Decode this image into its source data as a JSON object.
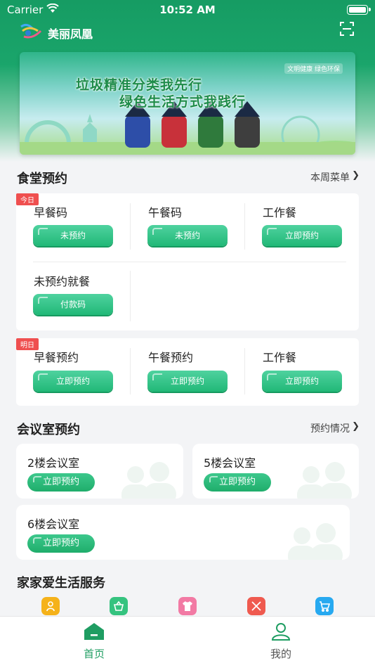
{
  "status_bar": {
    "carrier": "Carrier",
    "time": "10:52 AM"
  },
  "header": {
    "title": "美丽凤凰"
  },
  "banner": {
    "line1": "垃圾精准分类我先行",
    "line2": "绿色生活方式我践行",
    "tag": "文明健康 绿色环保"
  },
  "canteen": {
    "title": "食堂预约",
    "link": "本周菜单",
    "today": {
      "badge": "今日",
      "items": [
        {
          "label": "早餐码",
          "button": "未预约"
        },
        {
          "label": "午餐码",
          "button": "未预约"
        },
        {
          "label": "工作餐",
          "button": "立即预约"
        },
        {
          "label": "未预约就餐",
          "button": "付款码"
        }
      ]
    },
    "tomorrow": {
      "badge": "明日",
      "items": [
        {
          "label": "早餐预约",
          "button": "立即预约"
        },
        {
          "label": "午餐预约",
          "button": "立即预约"
        },
        {
          "label": "工作餐",
          "button": "立即预约"
        }
      ]
    }
  },
  "meeting": {
    "title": "会议室预约",
    "link": "预约情况",
    "rooms": [
      {
        "name": "2楼会议室",
        "button": "立即预约"
      },
      {
        "name": "5楼会议室",
        "button": "立即预约"
      },
      {
        "name": "6楼会议室",
        "button": "立即预约"
      }
    ]
  },
  "services": {
    "title": "家家爱生活服务",
    "icons": [
      {
        "name": "person-badge-icon",
        "color": "#f5b21a"
      },
      {
        "name": "basket-icon",
        "color": "#35c37f"
      },
      {
        "name": "shirt-icon",
        "color": "#f27aa4"
      },
      {
        "name": "utensils-icon",
        "color": "#ef5a4f"
      },
      {
        "name": "cart-icon",
        "color": "#27a9f0"
      }
    ]
  },
  "tabbar": {
    "home": "首页",
    "mine": "我的"
  },
  "colors": {
    "primary": "#1fb374",
    "accent_red": "#ef4f4f"
  }
}
